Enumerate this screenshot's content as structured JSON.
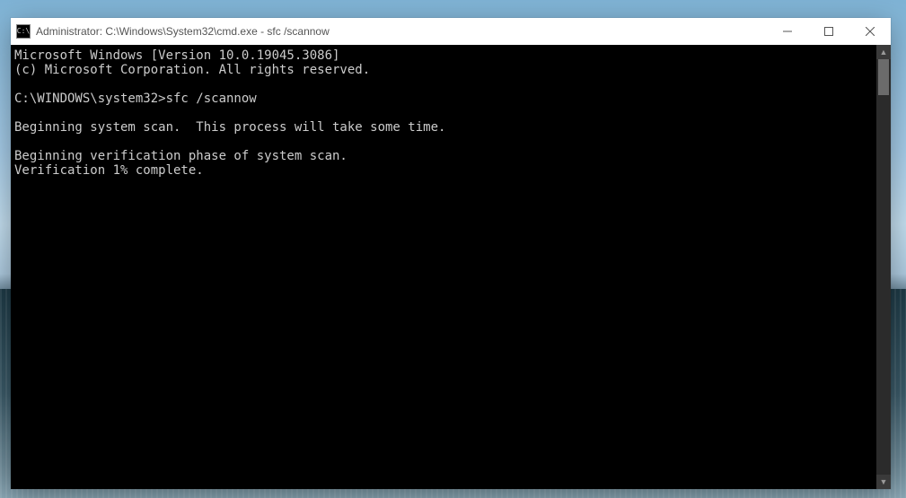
{
  "titlebar": {
    "title": "Administrator: C:\\Windows\\System32\\cmd.exe - sfc  /scannow",
    "cmd_icon_glyph": "C:\\"
  },
  "window_controls": {
    "minimize": "minimize",
    "maximize": "maximize",
    "close": "close"
  },
  "terminal": {
    "line_version": "Microsoft Windows [Version 10.0.19045.3086]",
    "line_copyright": "(c) Microsoft Corporation. All rights reserved.",
    "blank1": "",
    "prompt": "C:\\WINDOWS\\system32>",
    "command": "sfc /scannow",
    "blank2": "",
    "line_begin_scan": "Beginning system scan.  This process will take some time.",
    "blank3": "",
    "line_begin_verify": "Beginning verification phase of system scan.",
    "line_progress": "Verification 1% complete."
  },
  "scrollbar": {
    "up_glyph": "▲",
    "down_glyph": "▼"
  }
}
